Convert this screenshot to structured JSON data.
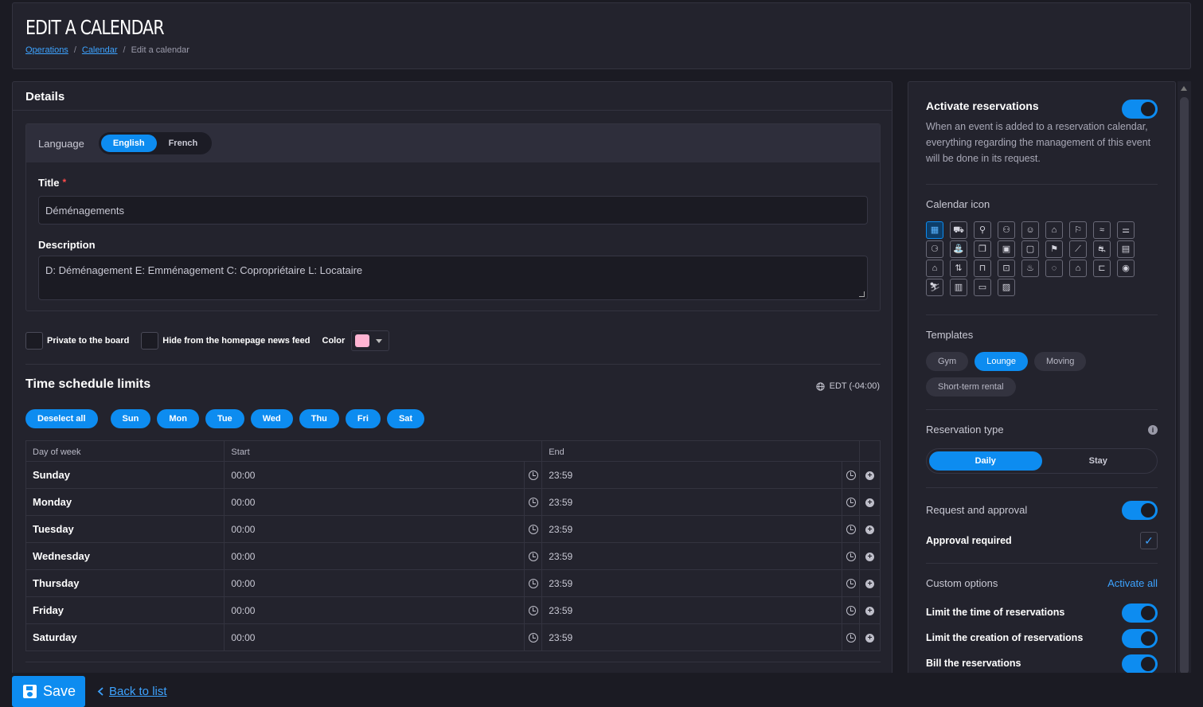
{
  "header": {
    "title": "EDIT A CALENDAR",
    "breadcrumb": {
      "operations": "Operations",
      "calendar": "Calendar",
      "current": "Edit a calendar"
    }
  },
  "details": {
    "heading": "Details",
    "language_label": "Language",
    "languages": [
      "English",
      "French"
    ],
    "selected_language": "English",
    "title_label": "Title",
    "title_value": "Déménagements",
    "description_label": "Description",
    "description_value": "D: Déménagement  E: Emménagement  C: Copropriétaire  L: Locataire",
    "private_label": "Private to the board",
    "hide_label": "Hide from the homepage news feed",
    "color_label": "Color",
    "color_value": "#ffb4d3"
  },
  "schedule": {
    "heading": "Time schedule limits",
    "timezone": "EDT (-04:00)",
    "deselect_label": "Deselect all",
    "day_buttons": [
      "Sun",
      "Mon",
      "Tue",
      "Wed",
      "Thu",
      "Fri",
      "Sat"
    ],
    "columns": [
      "Day of week",
      "Start",
      "End"
    ],
    "rows": [
      {
        "day": "Sunday",
        "start": "00:00",
        "end": "23:59"
      },
      {
        "day": "Monday",
        "start": "00:00",
        "end": "23:59"
      },
      {
        "day": "Tuesday",
        "start": "00:00",
        "end": "23:59"
      },
      {
        "day": "Wednesday",
        "start": "00:00",
        "end": "23:59"
      },
      {
        "day": "Thursday",
        "start": "00:00",
        "end": "23:59"
      },
      {
        "day": "Friday",
        "start": "00:00",
        "end": "23:59"
      },
      {
        "day": "Saturday",
        "start": "00:00",
        "end": "23:59"
      }
    ]
  },
  "reservations": {
    "activate_title": "Activate reservations",
    "activate_on": true,
    "activate_text": "When an event is added to a reservation calendar, everything regarding the management of this event will be done in its request.",
    "icon_label": "Calendar icon",
    "icons": [
      "calendar",
      "truck",
      "person-luggage",
      "people",
      "person",
      "tombstone",
      "runner",
      "swimmer",
      "dumbbell",
      "bicycle",
      "fountain",
      "gift-box",
      "calendar-day",
      "clipboard",
      "flag",
      "ramp",
      "car",
      "building",
      "garage",
      "elevator",
      "couch",
      "ticket",
      "cake",
      "chat",
      "house",
      "bed",
      "map-pin",
      "skier",
      "cabinet",
      "bench",
      "radio"
    ],
    "selected_icon": "calendar",
    "templates_label": "Templates",
    "templates": [
      "Gym",
      "Lounge",
      "Moving",
      "Short-term rental"
    ],
    "selected_template": "Lounge",
    "type_label": "Reservation type",
    "types": [
      "Daily",
      "Stay"
    ],
    "selected_type": "Daily",
    "request_label": "Request and approval",
    "request_on": true,
    "approval_label": "Approval required",
    "approval_checked": true,
    "custom_label": "Custom options",
    "activate_all": "Activate all",
    "options": [
      {
        "label": "Limit the time of reservations",
        "on": true
      },
      {
        "label": "Limit the creation of reservations",
        "on": true
      },
      {
        "label": "Bill the reservations",
        "on": true
      }
    ]
  },
  "footer": {
    "save": "Save",
    "back": "Back to list"
  }
}
